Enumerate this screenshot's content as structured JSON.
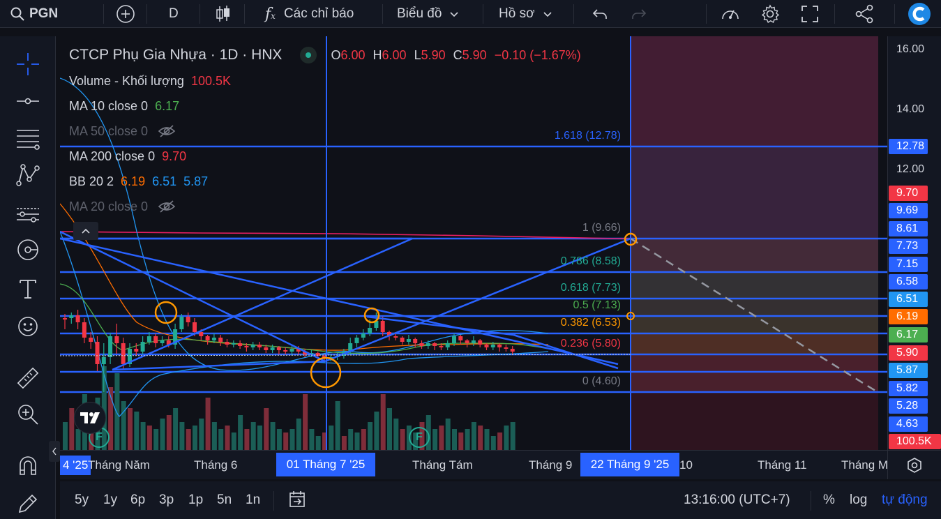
{
  "toolbar": {
    "symbol": "PGN",
    "interval": "D",
    "indicators_label": "Các chỉ báo",
    "charts_label": "Biểu đồ",
    "profile_label": "Hồ sơ"
  },
  "legend": {
    "title": "CTCP Phụ Gia Nhựa · 1D · HNX",
    "ohlc": {
      "o_label": "O",
      "o_value": "6.00",
      "h_label": "H",
      "h_value": "6.00",
      "l_label": "L",
      "l_value": "5.90",
      "c_label": "C",
      "c_value": "5.90",
      "change": "−0.10 (−1.67%)"
    },
    "indicators": [
      {
        "name": "Volume - Khối lượng",
        "values": [
          "100.5K"
        ],
        "colors": [
          "#f23645"
        ],
        "hidden": false
      },
      {
        "name": "MA 10 close 0",
        "values": [
          "6.17"
        ],
        "colors": [
          "#4caf50"
        ],
        "hidden": false
      },
      {
        "name": "MA 50 close 0",
        "values": [],
        "colors": [],
        "hidden": true
      },
      {
        "name": "MA 200 close 0",
        "values": [
          "9.70"
        ],
        "colors": [
          "#f23645"
        ],
        "hidden": false
      },
      {
        "name": "BB 20 2",
        "values": [
          "6.19",
          "6.51",
          "5.87"
        ],
        "colors": [
          "#ff6d00",
          "#2196f3",
          "#2196f3"
        ],
        "hidden": false
      },
      {
        "name": "MA 20 close 0",
        "values": [],
        "colors": [],
        "hidden": true
      }
    ]
  },
  "fib_levels": [
    {
      "label": "1.618 (12.78)",
      "price": 12.78,
      "color": "#2962ff"
    },
    {
      "label": "1 (9.66)",
      "price": 9.66,
      "color": "#787b86"
    },
    {
      "label": "0.786 (8.58)",
      "price": 8.58,
      "color": "#22ab94"
    },
    {
      "label": "0.618 (7.73)",
      "price": 7.73,
      "color": "#22ab94"
    },
    {
      "label": "0.5 (7.13)",
      "price": 7.13,
      "color": "#4caf50"
    },
    {
      "label": "0.382 (6.53)",
      "price": 6.53,
      "color": "#ff9800"
    },
    {
      "label": "0.236 (5.80)",
      "price": 5.8,
      "color": "#f23645"
    },
    {
      "label": "0 (4.60)",
      "price": 4.6,
      "color": "#787b86"
    }
  ],
  "price_scale": {
    "ticks": [
      "16.00",
      "14.00",
      "12.00"
    ],
    "tick_values": [
      16,
      14,
      12
    ],
    "badges": [
      {
        "text": "12.78",
        "price": 12.78,
        "bg": "#2962ff",
        "fg": "#ffffff"
      },
      {
        "text": "9.70",
        "price": 9.7,
        "bg": "#f23645",
        "fg": "#ffffff"
      },
      {
        "text": "9.69",
        "price": 9.69,
        "bg": "#2962ff",
        "fg": "#ffffff"
      },
      {
        "text": "8.61",
        "price": 8.61,
        "bg": "#2962ff",
        "fg": "#ffffff"
      },
      {
        "text": "7.73",
        "price": 7.73,
        "bg": "#2962ff",
        "fg": "#ffffff"
      },
      {
        "text": "7.15",
        "price": 7.15,
        "bg": "#2962ff",
        "fg": "#ffffff"
      },
      {
        "text": "6.58",
        "price": 6.58,
        "bg": "#2962ff",
        "fg": "#ffffff"
      },
      {
        "text": "6.51",
        "price": 6.51,
        "bg": "#2196f3",
        "fg": "#ffffff"
      },
      {
        "text": "6.19",
        "price": 6.19,
        "bg": "#ff6d00",
        "fg": "#ffffff"
      },
      {
        "text": "6.17",
        "price": 6.17,
        "bg": "#4caf50",
        "fg": "#ffffff"
      },
      {
        "text": "5.90",
        "price": 5.9,
        "bg": "#f23645",
        "fg": "#ffffff"
      },
      {
        "text": "5.87",
        "price": 5.87,
        "bg": "#2196f3",
        "fg": "#ffffff"
      },
      {
        "text": "5.82",
        "price": 5.82,
        "bg": "#2962ff",
        "fg": "#ffffff"
      },
      {
        "text": "5.28",
        "price": 5.28,
        "bg": "#2962ff",
        "fg": "#ffffff"
      },
      {
        "text": "4.63",
        "price": 4.63,
        "bg": "#2962ff",
        "fg": "#ffffff"
      },
      {
        "text": "100.5K",
        "price": null,
        "bg": "#f23645",
        "fg": "#ffffff"
      }
    ]
  },
  "time_axis": {
    "labels": [
      "4 '25",
      "Tháng Năm",
      "Tháng 6",
      "01 Tháng 7 '25",
      "Tháng Tám",
      "Tháng 9",
      "22 Tháng 9 '25",
      "10",
      "Tháng 11",
      "Tháng M"
    ]
  },
  "bottom": {
    "ranges": [
      "5y",
      "1y",
      "6p",
      "3p",
      "1p",
      "5n",
      "1n"
    ],
    "time": "13:16:00 (UTC+7)",
    "percent": "%",
    "log": "log",
    "auto": "tự động"
  },
  "markers": [
    "F",
    "F"
  ],
  "colors": {
    "up": "#22ab94",
    "down": "#f23645",
    "drawing": "#2962ff",
    "accent_orange": "#ff9800"
  }
}
